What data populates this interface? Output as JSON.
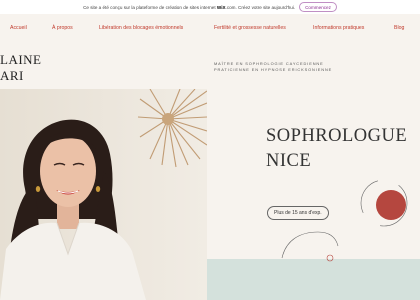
{
  "wix_banner": {
    "text_before": "Ce site a été conçu sur la plateforme de création de sites internet",
    "brand": "WiX",
    "text_after": ".com. Créez votre site aujourd'hui.",
    "button_label": "Commencez"
  },
  "nav": {
    "items": [
      "Accueil",
      "À propos",
      "Libération des blocages émotionnels",
      "Fertilité et grossesse naturelles",
      "Informations pratiques",
      "Blog"
    ]
  },
  "logo": {
    "line1": "LAINE",
    "line2": "ARI"
  },
  "tagline": {
    "line1": "MAÎTRE EN SOPHROLOGIE CAYCEDIENNE",
    "line2": "PRATICIENNE EN HYPNOSE ERICKSONIENNE"
  },
  "hero": {
    "title_line1": "SOPHROLOGUE",
    "title_line2": "NICE",
    "cta_label": "Plus de 15 ans d'exp."
  },
  "colors": {
    "page_bg": "#f7f3ee",
    "nav_link": "#c0392b",
    "accent_circle": "#b5473f",
    "mint_panel": "#d4e1dc"
  }
}
